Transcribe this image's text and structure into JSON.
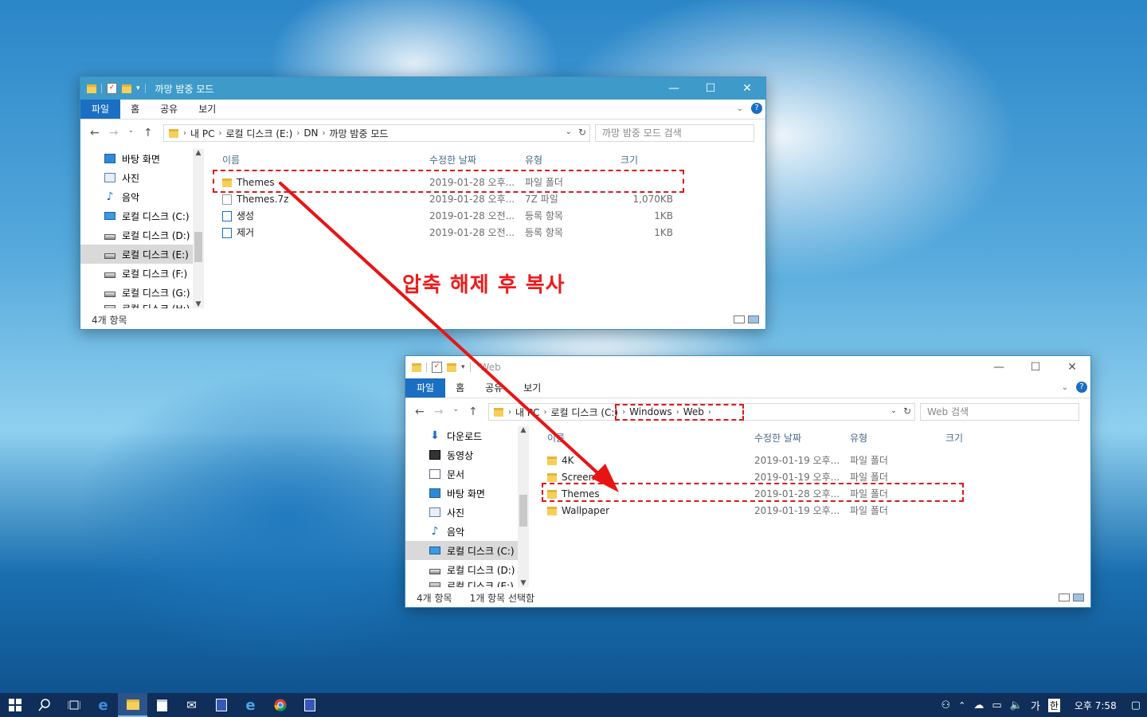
{
  "annotation": "압축 해제 후 복사",
  "window1": {
    "title": "까망 밤중 모드",
    "ribbon_tabs": [
      "파일",
      "홈",
      "공유",
      "보기"
    ],
    "address": [
      "내 PC",
      "로컬 디스크 (E:)",
      "DN",
      "까망 밤중 모드"
    ],
    "search_placeholder": "까망 밤중 모드 검색",
    "nav_items": [
      "바탕 화면",
      "사진",
      "음악",
      "로컬 디스크 (C:)",
      "로컬 디스크 (D:)",
      "로컬 디스크 (E:)",
      "로컬 디스크 (F:)",
      "로컬 디스크 (G:)",
      "로컬 디스크 (H:)"
    ],
    "columns": [
      "이름",
      "수정한 날짜",
      "유형",
      "크기"
    ],
    "rows": [
      {
        "name": "Themes",
        "date": "2019-01-28 오후...",
        "type": "파일 폴더",
        "size": ""
      },
      {
        "name": "Themes.7z",
        "date": "2019-01-28 오후...",
        "type": "7Z 파일",
        "size": "1,070KB"
      },
      {
        "name": "생성",
        "date": "2019-01-28 오전...",
        "type": "등록 항목",
        "size": "1KB"
      },
      {
        "name": "제거",
        "date": "2019-01-28 오전...",
        "type": "등록 항목",
        "size": "1KB"
      }
    ],
    "status": "4개 항목"
  },
  "window2": {
    "title": "Web",
    "ribbon_tabs": [
      "파일",
      "홈",
      "공유",
      "보기"
    ],
    "address": [
      "내 PC",
      "로컬 디스크 (C:)",
      "Windows",
      "Web"
    ],
    "search_placeholder": "Web 검색",
    "nav_items": [
      "다운로드",
      "동영상",
      "문서",
      "바탕 화면",
      "사진",
      "음악",
      "로컬 디스크 (C:)",
      "로컬 디스크 (D:)",
      "로컬 디스크 (E:)"
    ],
    "columns": [
      "이름",
      "수정한 날짜",
      "유형",
      "크기"
    ],
    "rows": [
      {
        "name": "4K",
        "date": "2019-01-19 오후...",
        "type": "파일 폴더"
      },
      {
        "name": "Screen",
        "date": "2019-01-19 오후...",
        "type": "파일 폴더"
      },
      {
        "name": "Themes",
        "date": "2019-01-28 오후...",
        "type": "파일 폴더"
      },
      {
        "name": "Wallpaper",
        "date": "2019-01-19 오후...",
        "type": "파일 폴더"
      }
    ],
    "status": "4개 항목",
    "status_selected": "1개 항목 선택함"
  },
  "taskbar": {
    "ime_lang": "가",
    "ime_mode": "한",
    "clock": "오후 7:58"
  },
  "icons": {
    "start": "windows-logo-icon",
    "search": "search-icon",
    "taskview": "task-view-icon",
    "edge": "edge-icon",
    "explorer": "file-explorer-icon",
    "store": "store-icon",
    "mail": "mail-icon",
    "chrome": "chrome-icon",
    "ie": "internet-explorer-icon"
  },
  "colors": {
    "annotation": "#ee1b1b",
    "titlebar_active": "#3e9bc9",
    "file_tab": "#1a6fc2",
    "taskbar": "#0f2e59"
  }
}
